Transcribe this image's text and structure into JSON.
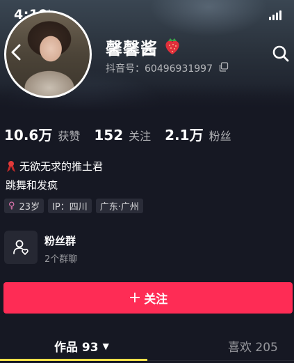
{
  "status_bar": {
    "time": "4:19"
  },
  "profile": {
    "name": "馨馨酱",
    "douyin_id": "抖音号：60496931997"
  },
  "stats": [
    {
      "value": "10.6万",
      "label": "获赞"
    },
    {
      "value": "152",
      "label": "关注"
    },
    {
      "value": "2.1万",
      "label": "粉丝"
    }
  ],
  "bio": {
    "line1": "无欲无求的推土君",
    "line2": "跳舞和发疯"
  },
  "tags": {
    "age": "23岁",
    "ip": "IP：四川",
    "location": "广东·广州"
  },
  "fan_group": {
    "title": "粉丝群",
    "subtitle": "2个群聊"
  },
  "follow_button": {
    "label": "关注"
  },
  "tabs": {
    "works": "作品 93",
    "likes": "喜欢 205"
  },
  "colors": {
    "background": "#161823",
    "follow": "#fe2c55",
    "tab_indicator": "#ffe24a",
    "gender": "#e779b4"
  }
}
